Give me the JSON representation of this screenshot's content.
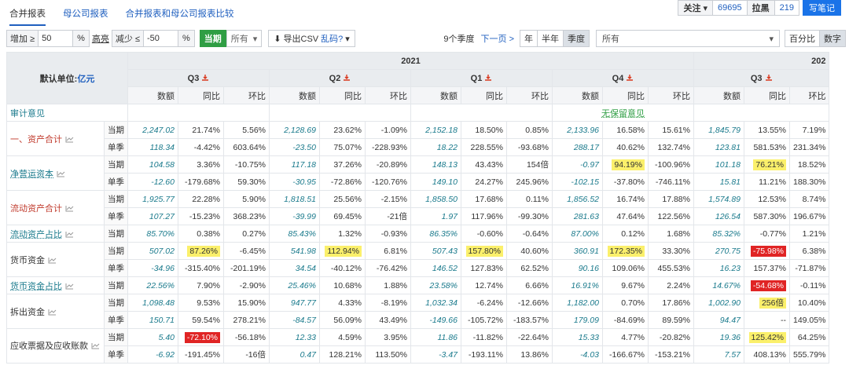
{
  "tabs": [
    "合并报表",
    "母公司报表",
    "合并报表和母公司报表比较"
  ],
  "topright": {
    "follow": "关注",
    "follow_count": "69695",
    "block": "拉黑",
    "block_count": "219",
    "note": "写笔记"
  },
  "toolbar": {
    "inc_label": "增加 ≥",
    "inc_value": "50",
    "pct": "%",
    "highlight": "高亮",
    "dec_label": "减少 ≤",
    "dec_value": "-50",
    "current": "当期",
    "all_opt": "所有",
    "export": "导出CSV",
    "garbled": "乱码?",
    "quarters": "9个季度",
    "next": "下一页 >",
    "seg_year": "年",
    "seg_half": "半年",
    "seg_quarter": "季度",
    "all_select": "所有",
    "pct_btn": "百分比",
    "num_btn": "数字"
  },
  "table": {
    "unit_label": "默认单位:",
    "unit": "亿元",
    "years": [
      "2021",
      "202"
    ],
    "quarters": [
      "Q3",
      "Q2",
      "Q1",
      "Q4",
      "Q3"
    ],
    "col_headers": [
      "数额",
      "同比",
      "环比"
    ],
    "audit_label": "审计意见",
    "audit_q4": "无保留意见",
    "rows": [
      {
        "name": "一、资产合计",
        "cls": "red",
        "chart": true,
        "period": "当期",
        "cells": [
          [
            "2,247.02",
            "21.74%",
            "5.56%"
          ],
          [
            "2,128.69",
            "23.62%",
            "-1.09%"
          ],
          [
            "2,152.18",
            "18.50%",
            "0.85%"
          ],
          [
            "2,133.96",
            "16.58%",
            "15.61%"
          ],
          [
            "1,845.79",
            "13.55%",
            "7.19%"
          ]
        ]
      },
      {
        "name": "",
        "period": "单季",
        "cells": [
          [
            "118.34",
            "-4.42%",
            "603.64%"
          ],
          [
            "-23.50",
            "75.07%",
            "-228.93%"
          ],
          [
            "18.22",
            "228.55%",
            "-93.68%"
          ],
          [
            "288.17",
            "40.62%",
            "132.74%"
          ],
          [
            "123.81",
            "581.53%",
            "231.34%"
          ]
        ]
      },
      {
        "name": "净营运资本",
        "cls": "blue",
        "chart": true,
        "period": "当期",
        "cells": [
          [
            "104.58",
            "3.36%",
            "-10.75%"
          ],
          [
            "117.18",
            "37.26%",
            "-20.89%"
          ],
          [
            "148.13",
            "43.43%",
            "154倍"
          ],
          [
            "-0.97",
            "94.19%|Y",
            "-100.96%"
          ],
          [
            "101.18",
            "76.21%|Y",
            "18.52%"
          ]
        ]
      },
      {
        "name": "",
        "period": "单季",
        "cells": [
          [
            "-12.60",
            "-179.68%",
            "59.30%"
          ],
          [
            "-30.95",
            "-72.86%",
            "-120.76%"
          ],
          [
            "149.10",
            "24.27%",
            "245.96%"
          ],
          [
            "-102.15",
            "-37.80%",
            "-746.11%"
          ],
          [
            "15.81",
            "11.21%",
            "188.30%"
          ]
        ]
      },
      {
        "name": "流动资产合计",
        "cls": "red",
        "chart": true,
        "period": "当期",
        "cells": [
          [
            "1,925.77",
            "22.28%",
            "5.90%"
          ],
          [
            "1,818.51",
            "25.56%",
            "-2.15%"
          ],
          [
            "1,858.50",
            "17.68%",
            "0.11%"
          ],
          [
            "1,856.52",
            "16.74%",
            "17.88%"
          ],
          [
            "1,574.89",
            "12.53%",
            "8.74%"
          ]
        ]
      },
      {
        "name": "",
        "period": "单季",
        "cells": [
          [
            "107.27",
            "-15.23%",
            "368.23%"
          ],
          [
            "-39.99",
            "69.45%",
            "-21倍"
          ],
          [
            "1.97",
            "117.96%",
            "-99.30%"
          ],
          [
            "281.63",
            "47.64%",
            "122.56%"
          ],
          [
            "126.54",
            "587.30%",
            "196.67%"
          ]
        ]
      },
      {
        "name": "流动资产占比",
        "cls": "blue",
        "chart": true,
        "period": "当期",
        "cells": [
          [
            "85.70%",
            "0.38%",
            "0.27%"
          ],
          [
            "85.43%",
            "1.32%",
            "-0.93%"
          ],
          [
            "86.35%",
            "-0.60%",
            "-0.64%"
          ],
          [
            "87.00%",
            "0.12%",
            "1.68%"
          ],
          [
            "85.32%",
            "-0.77%",
            "1.21%"
          ]
        ]
      },
      {
        "name": "货币资金",
        "cls": "black",
        "chart": true,
        "period": "当期",
        "cells": [
          [
            "507.02",
            "87.26%|Y",
            "-6.45%"
          ],
          [
            "541.98",
            "112.94%|Y",
            "6.81%"
          ],
          [
            "507.43",
            "157.80%|Y",
            "40.60%"
          ],
          [
            "360.91",
            "172.35%|Y",
            "33.30%"
          ],
          [
            "270.75",
            "-75.98%|R",
            "6.38%"
          ]
        ]
      },
      {
        "name": "",
        "period": "单季",
        "cells": [
          [
            "-34.96",
            "-315.40%",
            "-201.19%"
          ],
          [
            "34.54",
            "-40.12%",
            "-76.42%"
          ],
          [
            "146.52",
            "127.83%",
            "62.52%"
          ],
          [
            "90.16",
            "109.06%",
            "455.53%"
          ],
          [
            "16.23",
            "157.37%",
            "-71.87%"
          ]
        ]
      },
      {
        "name": "货币资金占比",
        "cls": "blue",
        "chart": true,
        "period": "当期",
        "cells": [
          [
            "22.56%",
            "7.90%",
            "-2.90%"
          ],
          [
            "25.46%",
            "10.68%",
            "1.88%"
          ],
          [
            "23.58%",
            "12.74%",
            "6.66%"
          ],
          [
            "16.91%",
            "9.67%",
            "2.24%"
          ],
          [
            "14.67%",
            "-54.68%|R",
            "-0.11%"
          ]
        ]
      },
      {
        "name": "拆出资金",
        "cls": "black",
        "chart": true,
        "period": "当期",
        "cells": [
          [
            "1,098.48",
            "9.53%",
            "15.90%"
          ],
          [
            "947.77",
            "4.33%",
            "-8.19%"
          ],
          [
            "1,032.34",
            "-6.24%",
            "-12.66%"
          ],
          [
            "1,182.00",
            "0.70%",
            "17.86%"
          ],
          [
            "1,002.90",
            "256倍|Y",
            "10.40%"
          ]
        ]
      },
      {
        "name": "",
        "period": "单季",
        "cells": [
          [
            "150.71",
            "59.54%",
            "278.21%"
          ],
          [
            "-84.57",
            "56.09%",
            "43.49%"
          ],
          [
            "-149.66",
            "-105.72%",
            "-183.57%"
          ],
          [
            "179.09",
            "-84.69%",
            "89.59%"
          ],
          [
            "94.47",
            "--",
            "149.05%"
          ]
        ]
      },
      {
        "name": "应收票据及应收账款",
        "cls": "black",
        "chart": true,
        "period": "当期",
        "cells": [
          [
            "5.40",
            "-72.10%|R",
            "-56.18%"
          ],
          [
            "12.33",
            "4.59%",
            "3.95%"
          ],
          [
            "11.86",
            "-11.82%",
            "-22.64%"
          ],
          [
            "15.33",
            "4.77%",
            "-20.82%"
          ],
          [
            "19.36",
            "125.42%|Y",
            "64.25%"
          ]
        ]
      },
      {
        "name": "",
        "period": "单季",
        "cells": [
          [
            "-6.92",
            "-191.45%",
            "-16倍"
          ],
          [
            "0.47",
            "128.21%",
            "113.50%"
          ],
          [
            "-3.47",
            "-193.11%",
            "13.86%"
          ],
          [
            "-4.03",
            "-166.67%",
            "-153.21%"
          ],
          [
            "7.57",
            "408.13%",
            "555.79%"
          ]
        ]
      }
    ]
  },
  "colors": {
    "accent": "#1a73e8",
    "teal": "#1a7a8c",
    "red": "#c0392b",
    "highlight_yellow": "#fbf06b",
    "highlight_red": "#e02424"
  }
}
